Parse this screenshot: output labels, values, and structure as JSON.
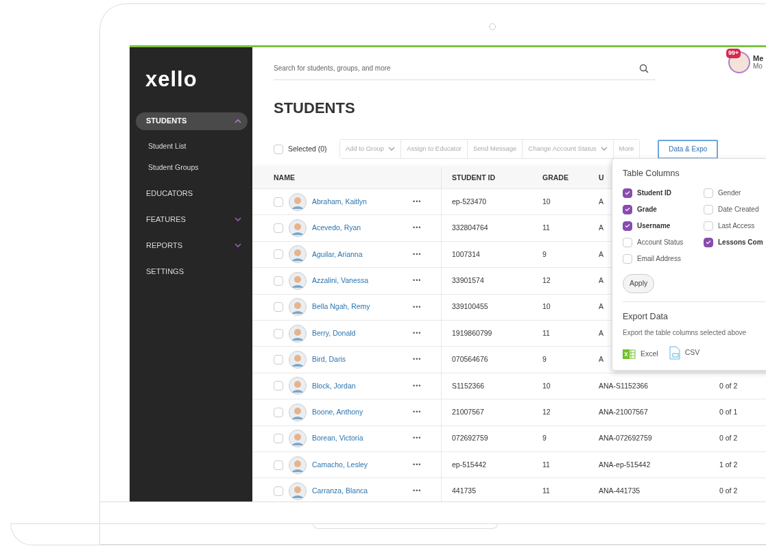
{
  "logo": "xello",
  "sidebar": {
    "items": [
      {
        "label": "STUDENTS",
        "kind": "group",
        "expanded": true,
        "selected": true,
        "children": [
          {
            "label": "Student List"
          },
          {
            "label": "Student Groups"
          }
        ]
      },
      {
        "label": "EDUCATORS",
        "kind": "link",
        "selected": false
      },
      {
        "label": "FEATURES",
        "kind": "group",
        "expanded": false,
        "selected": false
      },
      {
        "label": "REPORTS",
        "kind": "group",
        "expanded": false,
        "selected": false
      },
      {
        "label": "SETTINGS",
        "kind": "link",
        "selected": false
      }
    ]
  },
  "search": {
    "placeholder": "Search for students, groups, and more"
  },
  "user": {
    "badge": "99+",
    "name": "Me",
    "subtitle": "Mo"
  },
  "page_title": "STUDENTS",
  "toolbar": {
    "select_all": {
      "label": "Selected (0)",
      "checked": false
    },
    "actions": [
      {
        "label": "Add to Group",
        "dropdown": true,
        "disabled": true
      },
      {
        "label": "Assign to Educator",
        "dropdown": false,
        "disabled": true
      },
      {
        "label": "Send Message",
        "dropdown": false,
        "disabled": true
      },
      {
        "label": "Change Account Status",
        "dropdown": true,
        "disabled": true
      },
      {
        "label": "More",
        "dropdown": false,
        "disabled": true
      }
    ],
    "export_button": "Data & Expo"
  },
  "table": {
    "columns": [
      "NAME",
      "STUDENT ID",
      "GRADE",
      "U"
    ],
    "rows": [
      {
        "checked": false,
        "name": "Abraham, Kaitlyn",
        "more": "•••",
        "student_id": "ep-523470",
        "grade": "10",
        "column_4": "A"
      },
      {
        "checked": false,
        "name": "Acevedo, Ryan",
        "more": "•••",
        "student_id": "332804764",
        "grade": "11",
        "column_4": "A"
      },
      {
        "checked": false,
        "name": "Aguilar, Arianna",
        "more": "•••",
        "student_id": "1007314",
        "grade": "9",
        "column_4": "A"
      },
      {
        "checked": false,
        "name": "Azzalini, Vanessa",
        "more": "•••",
        "student_id": "33901574",
        "grade": "12",
        "column_4": "A"
      },
      {
        "checked": false,
        "name": "Bella Ngah, Remy",
        "more": "•••",
        "student_id": "339100455",
        "grade": "10",
        "column_4": "A"
      },
      {
        "checked": false,
        "name": "Berry, Donald",
        "more": "•••",
        "student_id": "1919860799",
        "grade": "11",
        "column_4": "A"
      },
      {
        "checked": false,
        "name": "Bird, Daris",
        "more": "•••",
        "student_id": "070564676",
        "grade": "9",
        "column_4": "A"
      },
      {
        "checked": false,
        "name": "Block, Jordan",
        "more": "•••",
        "student_id": "S1152366",
        "grade": "10",
        "column_4": "ANA-S1152366",
        "column_5": "0 of 2"
      },
      {
        "checked": false,
        "name": "Boone, Anthony",
        "more": "•••",
        "student_id": "21007567",
        "grade": "12",
        "column_4": "ANA-21007567",
        "column_5": "0 of 1"
      },
      {
        "checked": false,
        "name": "Borean, Victoria",
        "more": "•••",
        "student_id": "072692759",
        "grade": "9",
        "column_4": "ANA-072692759",
        "column_5": "0 of 2"
      },
      {
        "checked": false,
        "name": "Camacho, Lesley",
        "more": "•••",
        "student_id": "ep-515442",
        "grade": "11",
        "column_4": "ANA-ep-515442",
        "column_5": "1 of 2"
      },
      {
        "checked": false,
        "name": "Carranza, Blanca",
        "more": "•••",
        "student_id": "441735",
        "grade": "11",
        "column_4": "ANA-441735",
        "column_5": "0 of 2"
      }
    ]
  },
  "popover": {
    "title": "Table Columns",
    "options": [
      [
        {
          "label": "Student ID",
          "checked": true
        },
        {
          "label": "Grade",
          "checked": true
        },
        {
          "label": "Username",
          "checked": true
        },
        {
          "label": "Account Status",
          "checked": false
        },
        {
          "label": "Email Address",
          "checked": false
        }
      ],
      [
        {
          "label": "Gender",
          "checked": false
        },
        {
          "label": "Date Created",
          "checked": false
        },
        {
          "label": "Last Access",
          "checked": false
        },
        {
          "label": "Lessons Com",
          "checked": true
        }
      ]
    ],
    "apply": "Apply",
    "export_title": "Export Data",
    "export_text": "Export the table columns selected above",
    "exports": [
      {
        "label": "Excel",
        "kind": "excel"
      },
      {
        "label": "CSV",
        "kind": "csv"
      }
    ]
  }
}
